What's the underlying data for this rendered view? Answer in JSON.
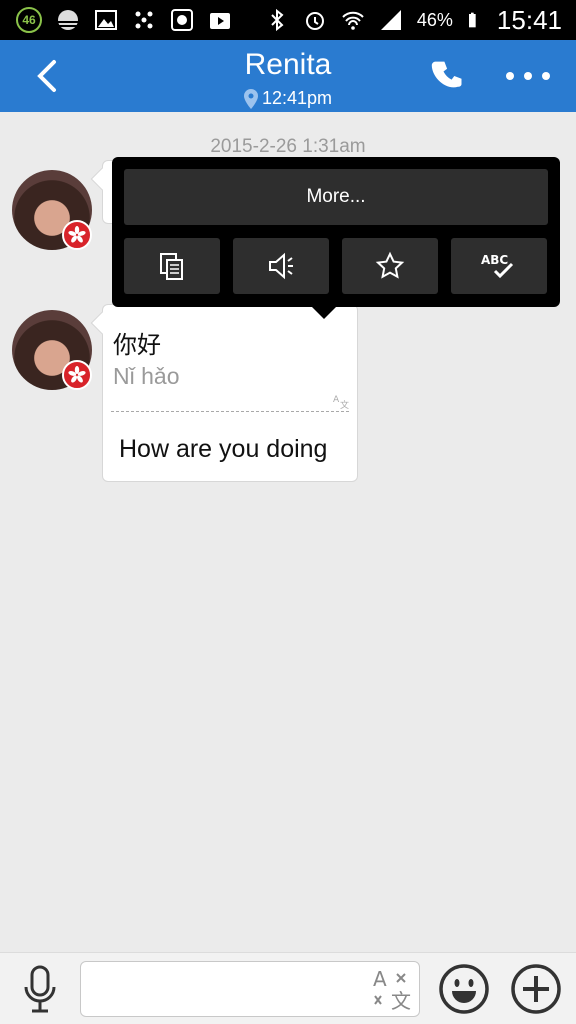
{
  "status_bar": {
    "badge": "46",
    "battery_pct": "46%",
    "time": "15:41"
  },
  "header": {
    "title": "Renita",
    "subtitle": "12:41pm"
  },
  "chat": {
    "timestamp": "2015-2-26 1:31am",
    "message": {
      "chinese": "你好",
      "pinyin": "Nǐ hǎo",
      "translation": "How are you doing"
    }
  },
  "popup": {
    "more_label": "More...",
    "actions": [
      "copy-icon",
      "speaker-icon",
      "star-icon",
      "spellcheck-icon"
    ]
  },
  "composer": {
    "value": "",
    "placeholder": ""
  },
  "colors": {
    "header_bg": "#2a7bd0",
    "background": "#ebebeb",
    "popup_bg": "#000000"
  }
}
